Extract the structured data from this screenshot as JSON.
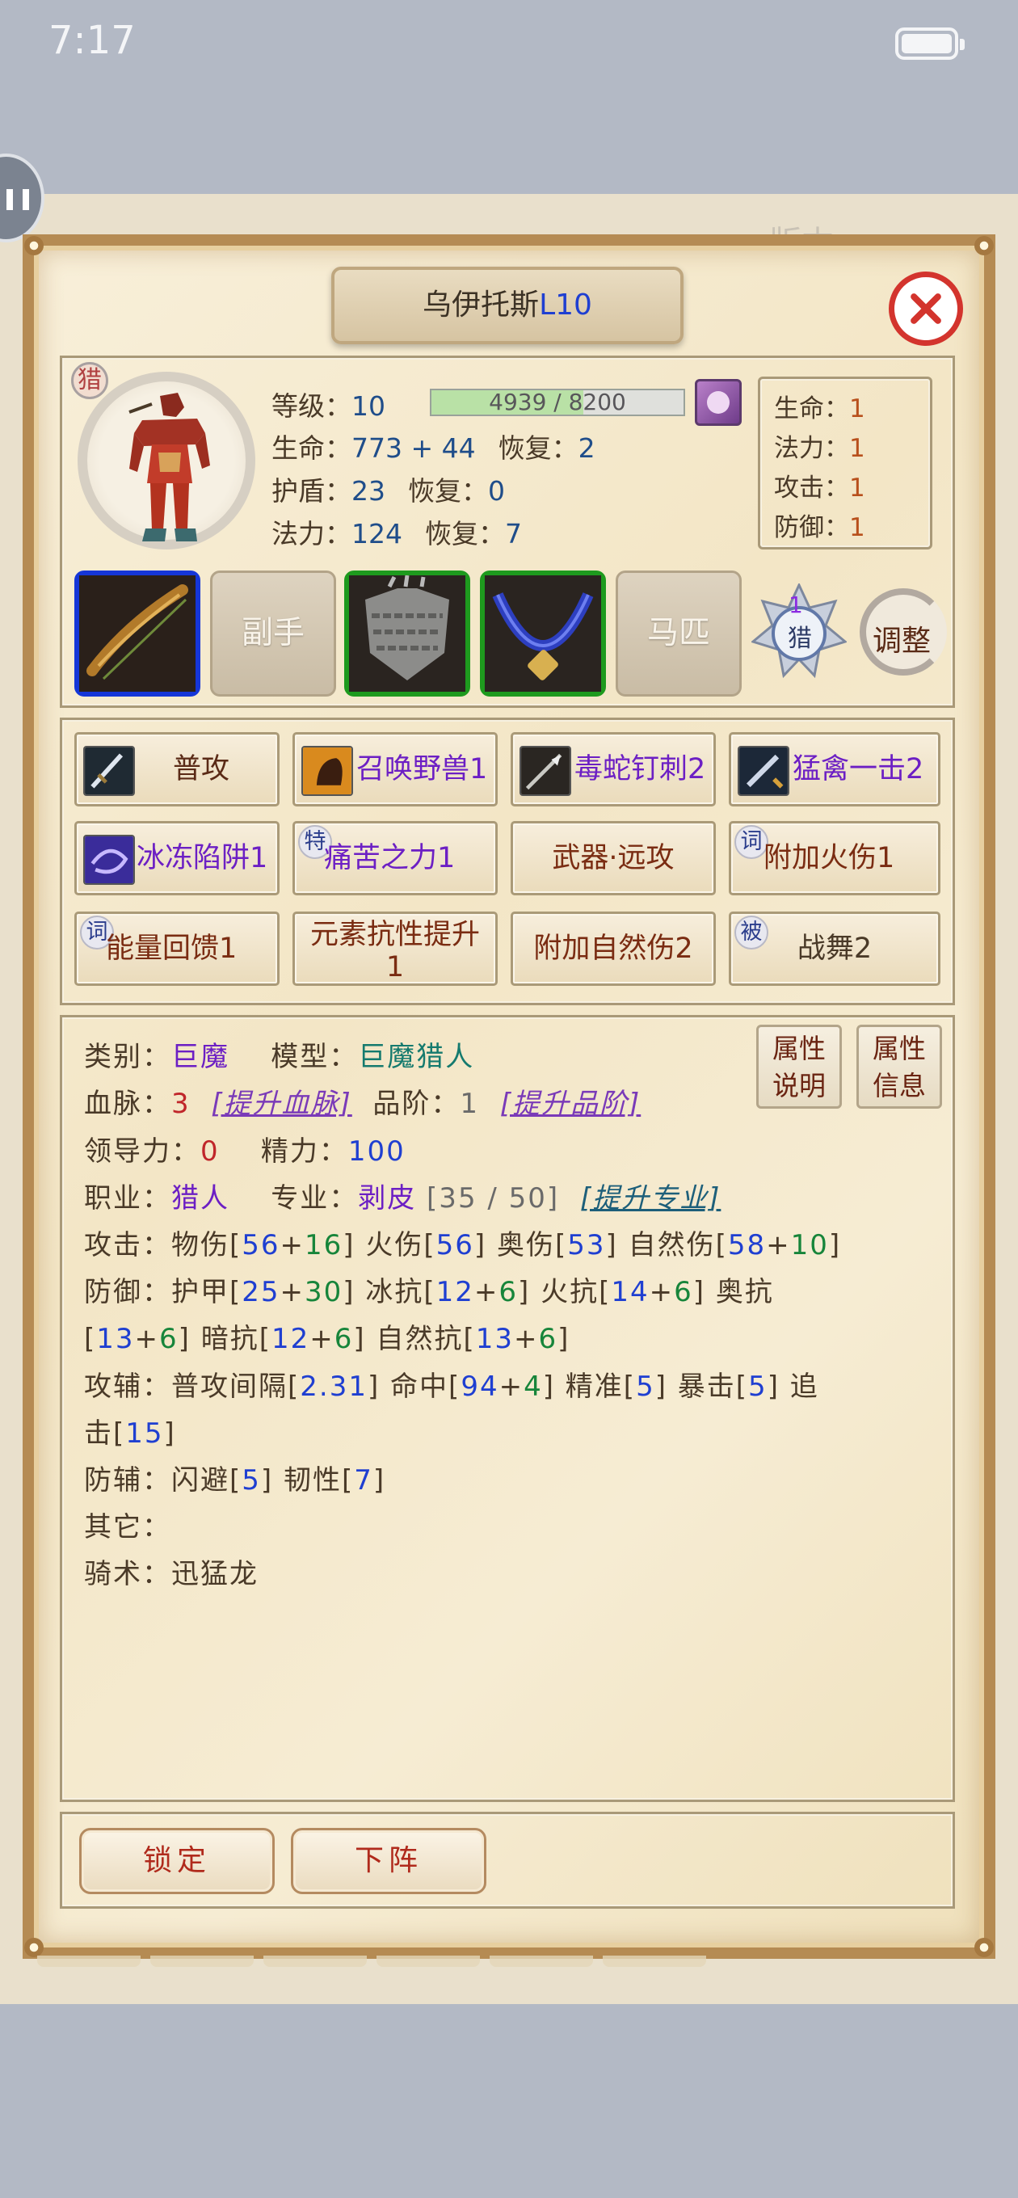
{
  "status_bar": {
    "time": "7:17"
  },
  "window": {
    "title_name": "乌伊托斯",
    "title_level": "L10"
  },
  "character": {
    "class_tag": "猎",
    "level_label": "等级：",
    "level_value": "10",
    "xp_text": "4939 / 8200",
    "xp_fraction": 0.602,
    "hp_label": "生命：",
    "hp_value": "773 + 44",
    "hp_regen_label": "恢复：",
    "hp_regen_value": "2",
    "shield_label": "护盾：",
    "shield_value": "23",
    "shield_regen_label": "恢复：",
    "shield_regen_value": "0",
    "mana_label": "法力：",
    "mana_value": "124",
    "mana_regen_label": "恢复：",
    "mana_regen_value": "7"
  },
  "bonus": [
    {
      "label": "生命：",
      "value": "1"
    },
    {
      "label": "法力：",
      "value": "1"
    },
    {
      "label": "攻击：",
      "value": "1"
    },
    {
      "label": "防御：",
      "value": "1"
    }
  ],
  "equipment": {
    "offhand_label": "副手",
    "mount_label": "马匹",
    "hunt_badge_number": "1",
    "hunt_badge_label": "猎",
    "adjust_label": "调整"
  },
  "skills": [
    {
      "name": "普攻",
      "icon": "sword-icon"
    },
    {
      "name": "召唤野兽1",
      "icon": "beast-icon"
    },
    {
      "name": "毒蛇钉刺2",
      "icon": "spear-icon"
    },
    {
      "name": "猛禽一击2",
      "icon": "strike-icon"
    },
    {
      "name": "冰冻陷阱1",
      "icon": "frost-icon"
    },
    {
      "name": "痛苦之力1",
      "tag": "特"
    },
    {
      "name": "武器·远攻"
    },
    {
      "name": "附加火伤1",
      "tag": "词"
    },
    {
      "name": "能量回馈1",
      "tag": "词"
    },
    {
      "name": "元素抗性提升",
      "name2": "1"
    },
    {
      "name": "附加自然伤2"
    },
    {
      "name": "战舞2",
      "tag": "被"
    }
  ],
  "info": {
    "category_label": "类别：",
    "category_value": "巨魔",
    "model_label": "模型：",
    "model_value": "巨魔猎人",
    "blood_label": "血脉：",
    "blood_value": "3",
    "blood_link": "[提升血脉]",
    "grade_label": "品阶：",
    "grade_value": "1",
    "grade_link": "[提升品阶]",
    "lead_label": "领导力：",
    "lead_value": "0",
    "energy_label": "精力：",
    "energy_value": "100",
    "job_label": "职业：",
    "job_value": "猎人",
    "spec_label": "专业：",
    "spec_value": "剥皮",
    "spec_progress": "[35 / 50]",
    "spec_link": "[提升专业]",
    "attack_label": "攻击：",
    "defense_label": "防御：",
    "atk_assist_label": "攻辅：",
    "def_assist_label": "防辅：",
    "other_label": "其它：",
    "riding_label": "骑术：",
    "riding_value": "迅猛龙",
    "attr_explain": [
      "属性",
      "说明"
    ],
    "attr_info": [
      "属性",
      "信息"
    ]
  },
  "attack_stats": {
    "phys": "56",
    "phys_bonus": "16",
    "fire": "56",
    "arcane": "53",
    "nature": "58",
    "nature_bonus": "10"
  },
  "defense_stats": {
    "armor": "25",
    "armor_bonus": "30",
    "frost": "12",
    "frost_bonus": "6",
    "fire": "14",
    "fire_bonus": "6",
    "arcane": "13",
    "arcane_bonus": "6",
    "shadow": "12",
    "shadow_bonus": "6",
    "nature": "13",
    "nature_bonus": "6"
  },
  "assist_stats": {
    "interval": "2.31",
    "hit": "94",
    "hit_bonus": "4",
    "precision": "5",
    "crit": "5",
    "chase": "15",
    "dodge": "5",
    "tough": "7"
  },
  "buttons": {
    "lock": "锁定",
    "remove": "下阵"
  },
  "colors": {
    "panel": "#f6ecd3",
    "frame": "#b58b53",
    "blue_value": "#1f3fd1",
    "green_bonus": "#17853a",
    "close": "#d3342d"
  }
}
